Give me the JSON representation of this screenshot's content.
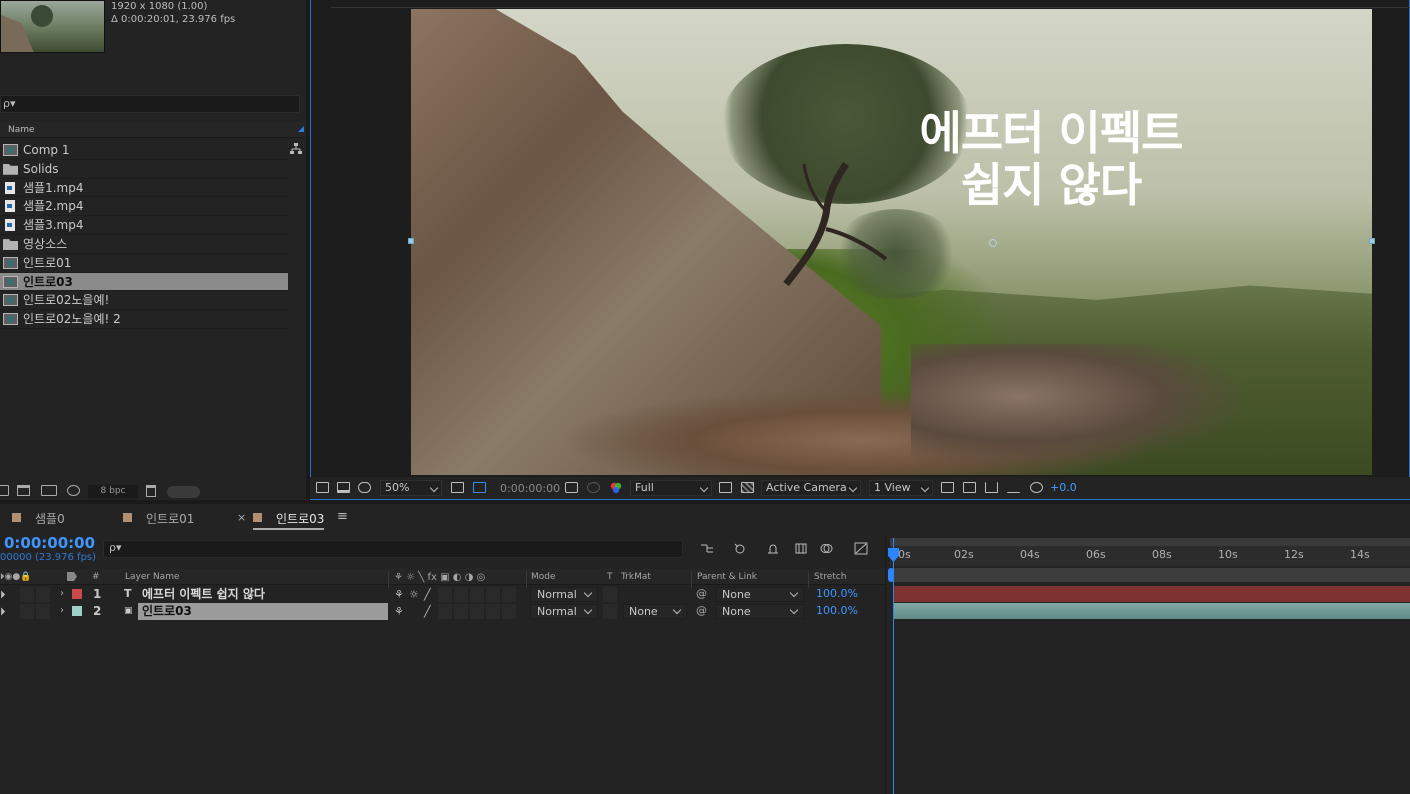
{
  "project": {
    "footage_info_resolution": "1920 x 1080 (1.00)",
    "footage_info_duration": "Δ 0:00:20:01, 23.976 fps",
    "search_placeholder": "ρ▾",
    "column_name": "Name",
    "items": [
      {
        "label": "Comp 1",
        "icon": "composition-icon",
        "selected": false
      },
      {
        "label": "Solids",
        "icon": "folder-icon",
        "selected": false
      },
      {
        "label": "샘플1.mp4",
        "icon": "video-file-icon",
        "selected": false
      },
      {
        "label": "샘플2.mp4",
        "icon": "video-file-icon",
        "selected": false
      },
      {
        "label": "샘플3.mp4",
        "icon": "video-file-icon",
        "selected": false
      },
      {
        "label": "영상소스",
        "icon": "folder-icon",
        "selected": false
      },
      {
        "label": "인트로01",
        "icon": "composition-icon",
        "selected": false
      },
      {
        "label": "인트로03",
        "icon": "composition-icon",
        "selected": true
      },
      {
        "label": "인트로02노을예!",
        "icon": "composition-icon",
        "selected": false
      },
      {
        "label": "인트로02노을예! 2",
        "icon": "composition-icon",
        "selected": false
      }
    ],
    "bpc": "8 bpc"
  },
  "viewer": {
    "title_line1": "에프터 이펙트",
    "title_line2": "쉽지 않다",
    "zoom": "50%",
    "timecode": "0:00:00:00",
    "resolution": "Full",
    "camera": "Active Camera",
    "views": "1 View",
    "exposure": "+0.0"
  },
  "timeline": {
    "tabs": [
      {
        "label": "샘플0",
        "active": false,
        "color": "#b09070"
      },
      {
        "label": "인트로01",
        "active": false,
        "color": "#b09070"
      },
      {
        "label": "인트로03",
        "active": true,
        "color": "#b09070"
      }
    ],
    "tab_close": "×",
    "tab_menu": "≡",
    "current_time": "0:00:00:00",
    "fps_info": "00000 (23.976 fps)",
    "search_placeholder": "ρ▾",
    "columns": {
      "hash": "#",
      "layer_name": "Layer Name",
      "mode": "Mode",
      "t": "T",
      "trkmat": "TrkMat",
      "parent": "Parent & Link",
      "stretch": "Stretch"
    },
    "layers": [
      {
        "num": "1",
        "type": "T",
        "name": "에프터 이펙트 쉽지 않다",
        "mode": "Normal",
        "trkmat": "",
        "parent": "None",
        "stretch": "100.0%",
        "label_color": "#c84a4a",
        "bar_color": "#7d3232"
      },
      {
        "num": "2",
        "type": "▣",
        "name": "인트로03",
        "mode": "Normal",
        "trkmat": "None",
        "parent": "None",
        "stretch": "100.0%",
        "label_color": "#9fd0c8",
        "bar_color": "#6e9b96"
      }
    ],
    "ruler_ticks": [
      "00s",
      "02s",
      "04s",
      "06s",
      "08s",
      "10s",
      "12s",
      "14s"
    ]
  }
}
